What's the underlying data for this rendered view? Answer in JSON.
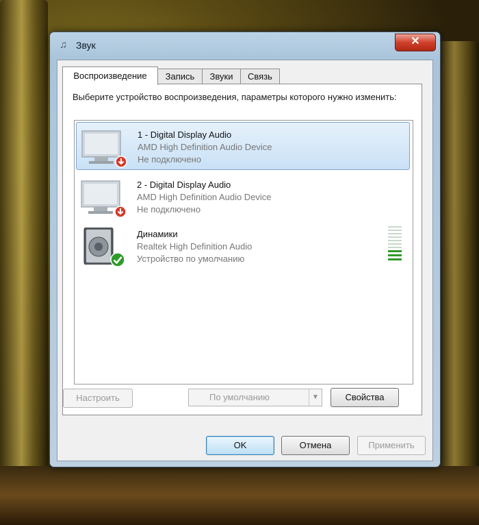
{
  "window": {
    "title": "Звук",
    "close_label": "✕"
  },
  "tabs": [
    {
      "label": "Воспроизведение"
    },
    {
      "label": "Запись"
    },
    {
      "label": "Звуки"
    },
    {
      "label": "Связь"
    }
  ],
  "instruction": "Выберите устройство воспроизведения, параметры которого нужно изменить:",
  "devices": [
    {
      "name": "1 - Digital Display Audio",
      "description": "AMD High Definition Audio Device",
      "status": "Не подключено",
      "icon": "monitor-icon",
      "badge": "disconnected-badge-icon"
    },
    {
      "name": "2 - Digital Display Audio",
      "description": "AMD High Definition Audio Device",
      "status": "Не подключено",
      "icon": "monitor-icon",
      "badge": "disconnected-badge-icon"
    },
    {
      "name": "Динамики",
      "description": "Realtek High Definition Audio",
      "status": "Устройство по умолчанию",
      "icon": "speaker-icon",
      "badge": "default-check-icon"
    }
  ],
  "buttons": {
    "configure": "Настроить",
    "set_default": "По умолчанию",
    "properties": "Свойства",
    "ok": "OK",
    "cancel": "Отмена",
    "apply": "Применить"
  },
  "colors": {
    "selection": "#c9e1f6",
    "meter_active": "#2f9a2a",
    "close": "#d0402a"
  }
}
